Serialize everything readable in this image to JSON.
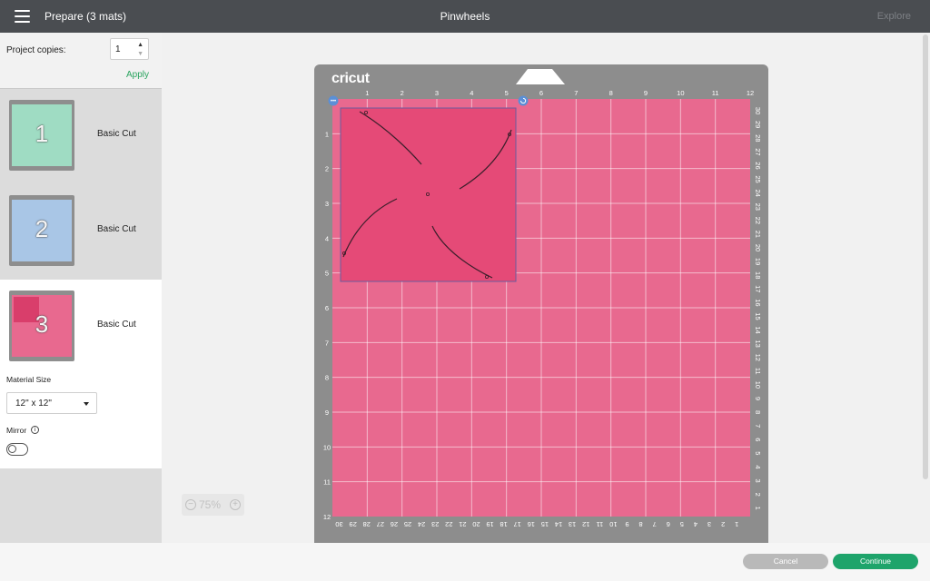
{
  "topbar": {
    "menu_icon": "hamburger-menu-icon",
    "left_title": "Prepare (3 mats)",
    "center_title": "Pinwheels",
    "explore": "Explore"
  },
  "sidebar": {
    "copies_label": "Project copies:",
    "copies_value": "1",
    "apply_label": "Apply",
    "mats": [
      {
        "number": "1",
        "label": "Basic Cut",
        "color": "#9fdcc3"
      },
      {
        "number": "2",
        "label": "Basic Cut",
        "color": "#a9c6e6"
      },
      {
        "number": "3",
        "label": "Basic Cut",
        "color": "#e8698f"
      }
    ],
    "material_size_label": "Material Size",
    "material_size_value": "12\" x 12\"",
    "mirror_label": "Mirror",
    "info_icon": "i"
  },
  "canvas": {
    "brand": "cricut",
    "zoom_minus": "−",
    "zoom_value": "75%",
    "zoom_plus": "+",
    "top_ruler": [
      "1",
      "2",
      "3",
      "4",
      "5",
      "6",
      "7",
      "8",
      "9",
      "10",
      "11",
      "12"
    ],
    "left_ruler": [
      "1",
      "2",
      "3",
      "4",
      "5",
      "6",
      "7",
      "8",
      "9",
      "10",
      "11",
      "12"
    ],
    "right_ruler": [
      "30",
      "29",
      "28",
      "27",
      "26",
      "25",
      "24",
      "23",
      "22",
      "21",
      "20",
      "19",
      "18",
      "17",
      "16",
      "15",
      "14",
      "13",
      "12",
      "11",
      "10",
      "9",
      "8",
      "7",
      "6",
      "5",
      "4",
      "3",
      "2",
      "1"
    ],
    "bottom_ruler": [
      "30",
      "29",
      "28",
      "27",
      "26",
      "25",
      "24",
      "23",
      "22",
      "21",
      "20",
      "19",
      "18",
      "17",
      "16",
      "15",
      "14",
      "13",
      "12",
      "11",
      "10",
      "9",
      "8",
      "7",
      "6",
      "5",
      "4",
      "3",
      "2",
      "1"
    ],
    "mat_color": "#e8698f",
    "design_color": "#e54a77"
  },
  "bottombar": {
    "cancel_label": "Cancel",
    "continue_label": "Continue"
  }
}
